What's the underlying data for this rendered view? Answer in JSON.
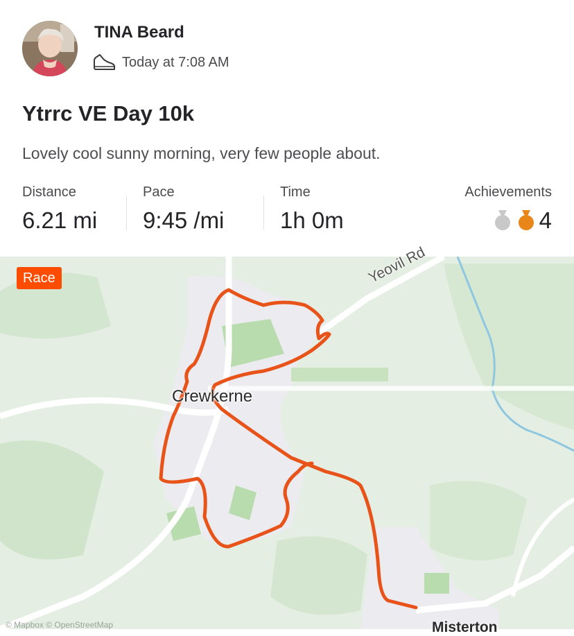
{
  "athlete": {
    "name": "TINA Beard",
    "timestamp": "Today at 7:08 AM",
    "activity_icon": "shoe-icon"
  },
  "activity": {
    "title": "Ytrrc VE Day 10k",
    "description": "Lovely cool sunny morning, very few people about."
  },
  "stats": [
    {
      "label": "Distance",
      "value": "6.21 mi"
    },
    {
      "label": "Pace",
      "value": "9:45 /mi"
    },
    {
      "label": "Time",
      "value": "1h 0m"
    }
  ],
  "achievements": {
    "label": "Achievements",
    "count": "4",
    "medals": [
      {
        "icon": "silver-medal-icon",
        "color": "#c8c8c8"
      },
      {
        "icon": "bronze-medal-icon",
        "color": "#e8861a"
      }
    ]
  },
  "map": {
    "badge": "Race",
    "town_label": "Crewkerne",
    "road_label": "Yeovil Rd",
    "village_label": "Misterton",
    "attribution": "© Mapbox © OpenStreetMap",
    "route_color": "#e8531a"
  },
  "colors": {
    "accent": "#fc4c02",
    "text_primary": "#242428",
    "text_secondary": "#4a4a4f"
  }
}
